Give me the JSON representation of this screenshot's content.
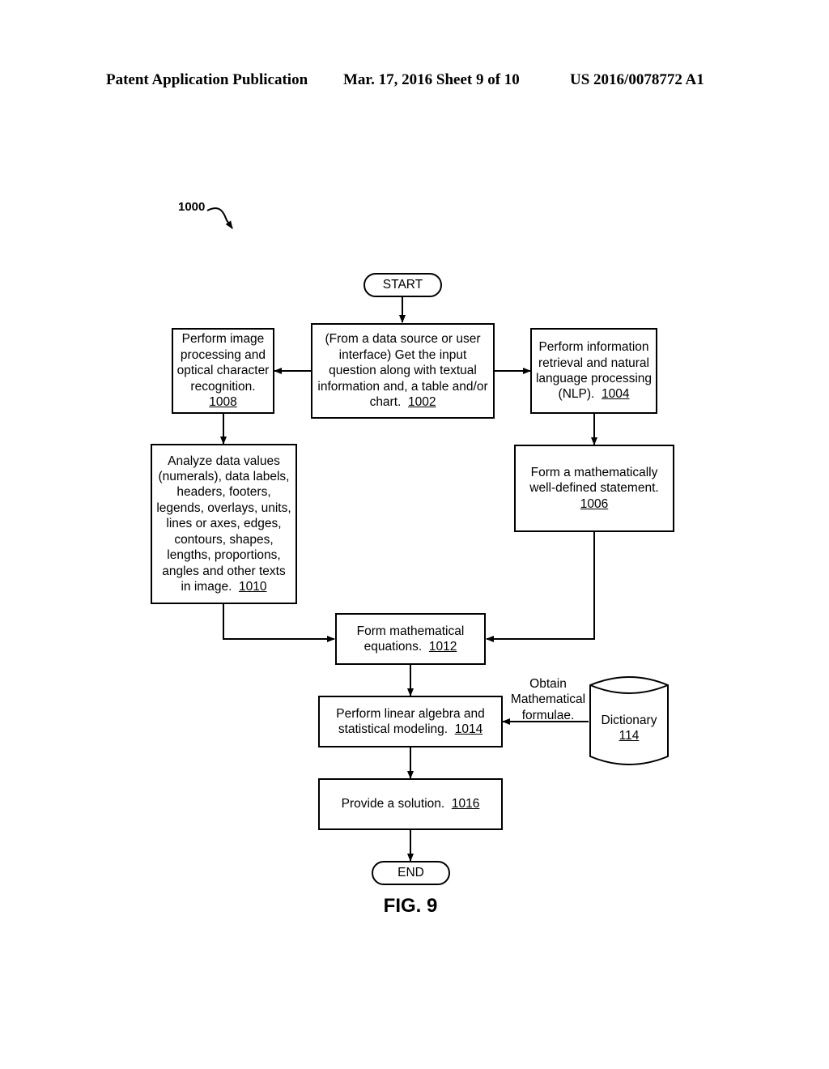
{
  "header": {
    "left": "Patent Application Publication",
    "middle": "Mar. 17, 2016  Sheet 9 of 10",
    "right": "US 2016/0078772 A1"
  },
  "figure_ref": "1000",
  "figure_caption": "FIG. 9",
  "nodes": {
    "start": {
      "label": "START"
    },
    "n1002": {
      "lines": [
        "(From a data source or user",
        "interface) Get the input",
        "question along with textual",
        "information and, a table and/or"
      ],
      "last": "chart.",
      "ref": "1002"
    },
    "n1004": {
      "lines": [
        "Perform information",
        "retrieval and natural",
        "language processing"
      ],
      "last": "(NLP).",
      "ref": "1004"
    },
    "n1006": {
      "lines": [
        "Form a mathematically",
        "well-defined statement."
      ],
      "last": "",
      "ref": "1006"
    },
    "n1008": {
      "lines": [
        "Perform image",
        "processing and",
        "optical character",
        "recognition."
      ],
      "last": "",
      "ref": "1008"
    },
    "n1010": {
      "lines": [
        "Analyze data values",
        "(numerals), data labels,",
        "headers, footers,",
        "legends, overlays, units,",
        "lines or axes, edges,",
        "contours, shapes,",
        "lengths, proportions,",
        "angles and other texts"
      ],
      "last": "in image.",
      "ref": "1010"
    },
    "n1012": {
      "lines": [
        "Form mathematical"
      ],
      "last": "equations.",
      "ref": "1012"
    },
    "n1014": {
      "lines": [
        "Perform linear algebra and"
      ],
      "last": "statistical modeling.",
      "ref": "1014"
    },
    "n1016": {
      "lines": [],
      "last": "Provide a solution.",
      "ref": "1016"
    },
    "end": {
      "label": "END"
    },
    "dictionary": {
      "label": "Dictionary",
      "ref": "114"
    }
  },
  "edge_labels": {
    "dictionary_to_1014": [
      "Obtain",
      "Mathematical",
      "formulae."
    ]
  }
}
